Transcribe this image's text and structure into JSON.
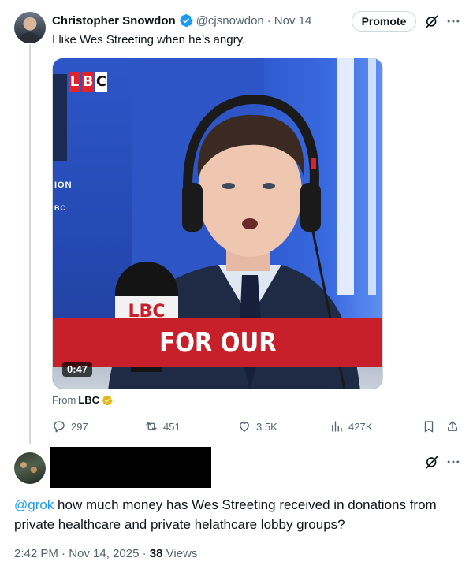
{
  "tweet": {
    "author_name": "Christopher Snowdon",
    "handle": "@cjsnowdon",
    "separator": "·",
    "date": "Nov 14",
    "promote_label": "Promote",
    "text": "I like Wes Streeting when he’s angry.",
    "video": {
      "logo_letters": [
        "L",
        "B",
        "C"
      ],
      "mic_logo": "LBC",
      "caption": "FOR OUR",
      "duration": "0:47",
      "wall_text_1": "ION",
      "wall_text_2": "BC"
    },
    "from_prefix": "From",
    "from_source": "LBC",
    "stats": {
      "replies": "297",
      "reposts": "451",
      "likes": "3.5K",
      "views": "427K"
    }
  },
  "reply": {
    "mention": "@grok",
    "text": " how much money has Wes Streeting received in donations from private healthcare and private helathcare lobby groups?",
    "time": "2:42 PM",
    "separator": "·",
    "date": "Nov 14, 2025",
    "separator2": "·",
    "views_count": "38",
    "views_label": "Views"
  },
  "colors": {
    "accent": "#1d9bf0",
    "secondary_text": "#536471",
    "lbc_red": "#c8202b"
  },
  "icons": [
    "verified-badge-icon",
    "grok-icon",
    "more-icon",
    "reply-icon",
    "repost-icon",
    "like-icon",
    "views-icon",
    "bookmark-icon",
    "share-icon"
  ]
}
